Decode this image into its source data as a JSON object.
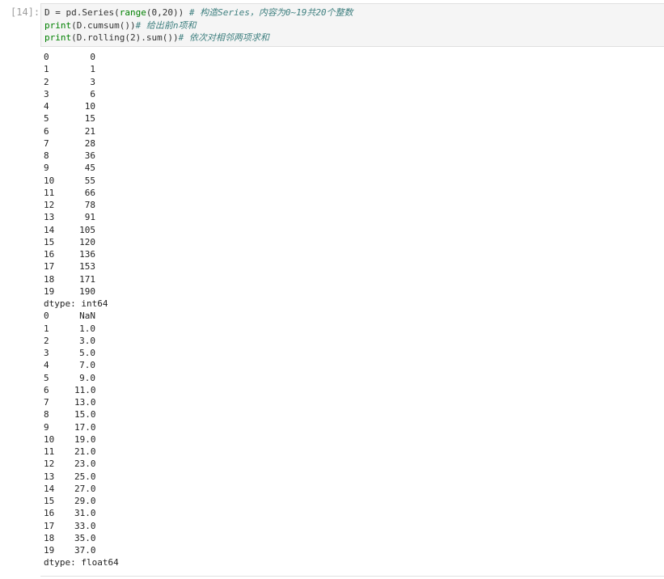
{
  "prompt": "[14]:",
  "code": {
    "line1_var": "D = pd.",
    "line1_fn": "Series",
    "line1_open": "(",
    "line1_range": "range",
    "line1_args": "(0,20)) ",
    "line1_comment": "# 构造Series，内容为0~19共20个整数",
    "line2_print": "print",
    "line2_body": "(D.cumsum())",
    "line2_comment": "# 给出前n项和",
    "line3_print": "print",
    "line3_body": "(D.rolling(2).sum())",
    "line3_comment": "# 依次对相邻两项求和"
  },
  "output": {
    "series1": [
      {
        "i": "0",
        "v": "0"
      },
      {
        "i": "1",
        "v": "1"
      },
      {
        "i": "2",
        "v": "3"
      },
      {
        "i": "3",
        "v": "6"
      },
      {
        "i": "4",
        "v": "10"
      },
      {
        "i": "5",
        "v": "15"
      },
      {
        "i": "6",
        "v": "21"
      },
      {
        "i": "7",
        "v": "28"
      },
      {
        "i": "8",
        "v": "36"
      },
      {
        "i": "9",
        "v": "45"
      },
      {
        "i": "10",
        "v": "55"
      },
      {
        "i": "11",
        "v": "66"
      },
      {
        "i": "12",
        "v": "78"
      },
      {
        "i": "13",
        "v": "91"
      },
      {
        "i": "14",
        "v": "105"
      },
      {
        "i": "15",
        "v": "120"
      },
      {
        "i": "16",
        "v": "136"
      },
      {
        "i": "17",
        "v": "153"
      },
      {
        "i": "18",
        "v": "171"
      },
      {
        "i": "19",
        "v": "190"
      }
    ],
    "dtype1": "dtype: int64",
    "series2": [
      {
        "i": "0",
        "v": "NaN"
      },
      {
        "i": "1",
        "v": "1.0"
      },
      {
        "i": "2",
        "v": "3.0"
      },
      {
        "i": "3",
        "v": "5.0"
      },
      {
        "i": "4",
        "v": "7.0"
      },
      {
        "i": "5",
        "v": "9.0"
      },
      {
        "i": "6",
        "v": "11.0"
      },
      {
        "i": "7",
        "v": "13.0"
      },
      {
        "i": "8",
        "v": "15.0"
      },
      {
        "i": "9",
        "v": "17.0"
      },
      {
        "i": "10",
        "v": "19.0"
      },
      {
        "i": "11",
        "v": "21.0"
      },
      {
        "i": "12",
        "v": "23.0"
      },
      {
        "i": "13",
        "v": "25.0"
      },
      {
        "i": "14",
        "v": "27.0"
      },
      {
        "i": "15",
        "v": "29.0"
      },
      {
        "i": "16",
        "v": "31.0"
      },
      {
        "i": "17",
        "v": "33.0"
      },
      {
        "i": "18",
        "v": "35.0"
      },
      {
        "i": "19",
        "v": "37.0"
      }
    ],
    "dtype2": "dtype: float64"
  }
}
